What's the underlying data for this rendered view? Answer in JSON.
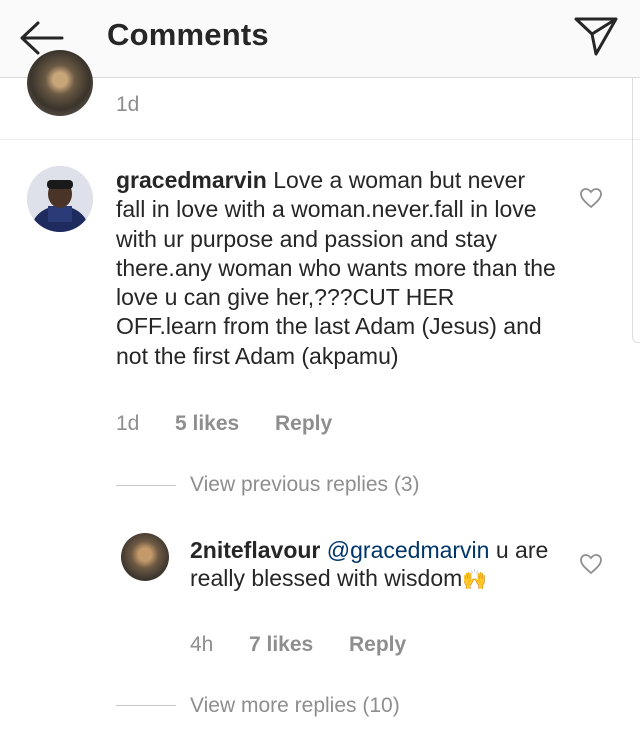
{
  "header": {
    "title": "Comments",
    "back_icon": "arrow-left-icon",
    "share_icon": "paper-plane-icon"
  },
  "previous_comment": {
    "time": "1d"
  },
  "comment": {
    "username": "gracedmarvin",
    "text": "Love a woman but never fall in love with a woman.never.fall in love with ur purpose and passion and stay there.any woman who wants more than the love u can give her,???CUT HER OFF.learn from the last Adam (Jesus) and not the first Adam (akpamu)",
    "time": "1d",
    "likes": "5 likes",
    "reply_label": "Reply"
  },
  "view_previous": "View previous replies (3)",
  "reply": {
    "username": "2niteflavour",
    "mention": "@gracedmarvin",
    "text": "u are really blessed with wisdom",
    "emoji": "🙌",
    "time": "4h",
    "likes": "7 likes",
    "reply_label": "Reply"
  },
  "view_more": "View more replies (10)",
  "colors": {
    "text": "#262626",
    "muted": "#8e8e8e",
    "mention": "#003569"
  }
}
